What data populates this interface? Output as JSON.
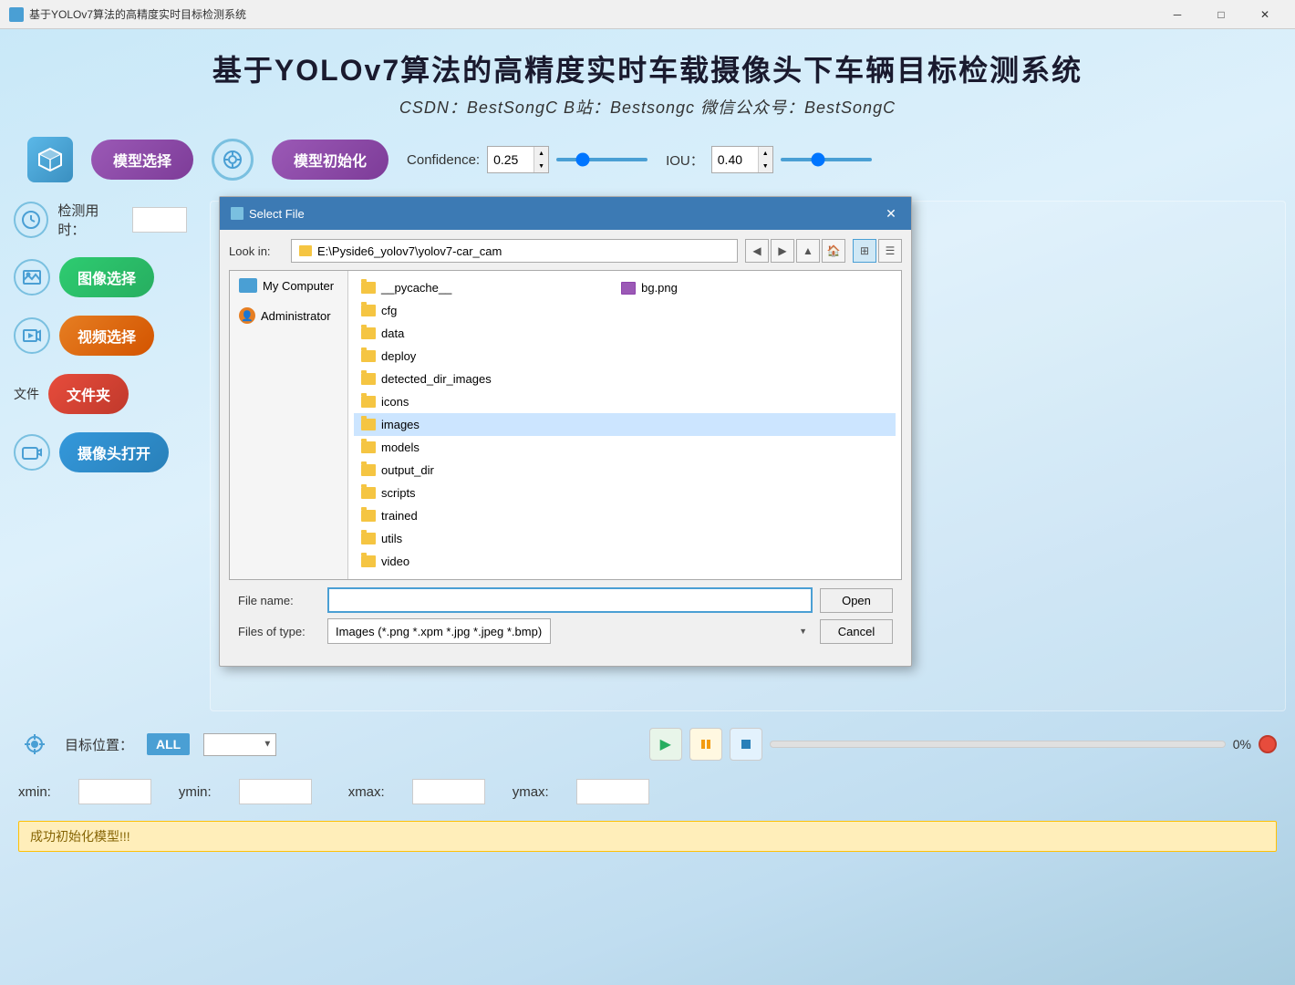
{
  "titlebar": {
    "title": "基于YOLOv7算法的高精度实时目标检测系统",
    "min_btn": "─",
    "max_btn": "□",
    "close_btn": "✕"
  },
  "header": {
    "title": "基于YOLOv7算法的高精度实时车载摄像头下车辆目标检测系统",
    "subtitle": "CSDN：BestSongC  B站：Bestsongc  微信公众号：BestSongC"
  },
  "toolbar": {
    "model_select_btn": "模型选择",
    "model_init_btn": "模型初始化",
    "confidence_label": "Confidence:",
    "confidence_val": "0.25",
    "iou_label": "IOU：",
    "iou_val": "0.40"
  },
  "sidebar": {
    "detect_time_label": "检测用时：",
    "image_select_btn": "图像选择",
    "video_select_btn": "视频选择",
    "folder_label": "文件",
    "folder_btn": "文件夹",
    "camera_btn": "摄像头打开"
  },
  "bottom": {
    "target_label": "目标位置：",
    "all_badge": "ALL",
    "xmin_label": "xmin:",
    "ymin_label": "ymin:",
    "xmax_label": "xmax:",
    "ymax_label": "ymax:",
    "progress_pct": "0%",
    "status_msg": "成功初始化模型!!!",
    "play_btn": "▶",
    "pause_btn": "⏸",
    "stop_btn": "⏹"
  },
  "dialog": {
    "title": "Select File",
    "lookin_label": "Look in:",
    "lookin_path": "E:\\Pyside6_yolov7\\yolov7-car_cam",
    "places": [
      {
        "name": "My Computer",
        "type": "computer"
      },
      {
        "name": "Administrator",
        "type": "user"
      }
    ],
    "files": [
      {
        "name": "__pycache__",
        "type": "folder"
      },
      {
        "name": "bg.png",
        "type": "image"
      },
      {
        "name": "cfg",
        "type": "folder"
      },
      {
        "name": "",
        "type": ""
      },
      {
        "name": "data",
        "type": "folder"
      },
      {
        "name": "",
        "type": ""
      },
      {
        "name": "deploy",
        "type": "folder"
      },
      {
        "name": "",
        "type": ""
      },
      {
        "name": "detected_dir_images",
        "type": "folder"
      },
      {
        "name": "",
        "type": ""
      },
      {
        "name": "icons",
        "type": "folder"
      },
      {
        "name": "",
        "type": ""
      },
      {
        "name": "images",
        "type": "folder",
        "selected": true
      },
      {
        "name": "",
        "type": ""
      },
      {
        "name": "models",
        "type": "folder"
      },
      {
        "name": "",
        "type": ""
      },
      {
        "name": "output_dir",
        "type": "folder"
      },
      {
        "name": "",
        "type": ""
      },
      {
        "name": "scripts",
        "type": "folder"
      },
      {
        "name": "",
        "type": ""
      },
      {
        "name": "trained",
        "type": "folder"
      },
      {
        "name": "",
        "type": ""
      },
      {
        "name": "utils",
        "type": "folder"
      },
      {
        "name": "",
        "type": ""
      },
      {
        "name": "video",
        "type": "folder"
      },
      {
        "name": "",
        "type": ""
      }
    ],
    "filename_label": "File name:",
    "filetype_label": "Files of type:",
    "filetype_val": "Images (*.png *.xpm *.jpg *.jpeg *.bmp)",
    "open_btn": "Open",
    "cancel_btn": "Cancel"
  }
}
